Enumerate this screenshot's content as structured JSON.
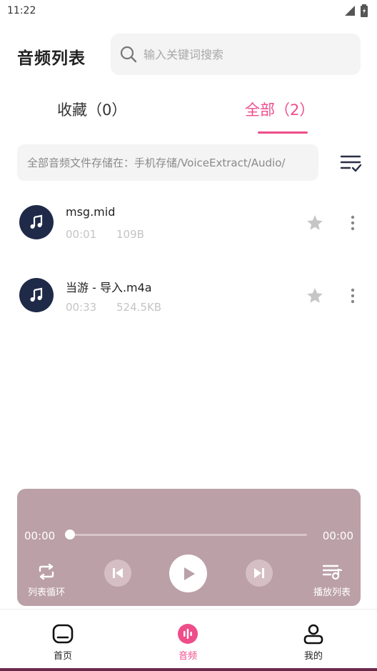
{
  "status_bar": {
    "time": "11:22",
    "icons": [
      "signal-icon",
      "battery-icon"
    ]
  },
  "header": {
    "title": "音频列表",
    "search_placeholder": "输入关键词搜索"
  },
  "tabs": [
    {
      "label": "收藏（0）",
      "active": false
    },
    {
      "label": "全部（2）",
      "active": true
    }
  ],
  "storage_path": "全部音频文件存储在：手机存储/VoiceExtract/Audio/",
  "audio_list": [
    {
      "name": "msg.mid",
      "duration": "00:01",
      "size": "109B",
      "icon": "music-note-icon"
    },
    {
      "name": "当游 - 导入.m4a",
      "duration": "00:33",
      "size": "524.5KB",
      "icon": "music-note-icon"
    }
  ],
  "player": {
    "current_time": "00:00",
    "total_time": "00:00",
    "progress": 0,
    "loop_label": "列表循环",
    "playlist_label": "播放列表"
  },
  "bottom_nav": [
    {
      "label": "首页",
      "icon": "home-icon",
      "active": false
    },
    {
      "label": "音频",
      "icon": "audio-icon",
      "active": true
    },
    {
      "label": "我的",
      "icon": "user-icon",
      "active": false
    }
  ],
  "colors": {
    "accent": "#ee4d8a",
    "player_bg": "#bba0a8",
    "avatar_bg": "#1f2a48"
  }
}
